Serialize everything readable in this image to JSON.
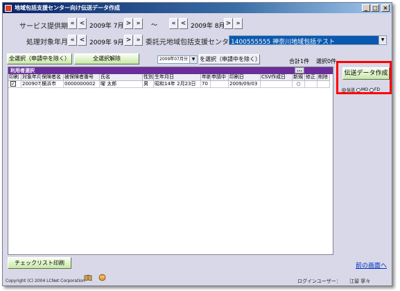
{
  "window": {
    "title": "地域包括支援センター向け伝送データ作成",
    "btn_minimize": "_",
    "btn_maximize": "□",
    "btn_close": "×"
  },
  "filters": {
    "service_period_label": "サービス提供期間",
    "period_from": "2009年 7月",
    "tilde": "～",
    "period_to": "2009年 8月",
    "process_month_label": "処理対象年月",
    "process_month": "2009年 9月",
    "consign_label": "委託元地域包括支援センター",
    "consign_value": "1400555555 神奈川地域包括テスト",
    "nav_first": "«",
    "nav_prev": "<",
    "nav_next": ">",
    "nav_last": "»"
  },
  "toolbar": {
    "select_all": "全選択（申請中を除く）",
    "deselect_all": "全選択解除",
    "month_combo": "2009年07月分",
    "select_month": "を選択（申請中を除く）",
    "total_label": "合計",
    "total_count": "1件",
    "selected_label": "選択",
    "selected_count": "0件"
  },
  "grid": {
    "title": "利用者選択",
    "ellipsis": "...",
    "columns": [
      "印刷",
      "対象年月",
      "保険者名",
      "被保険者番号",
      "氏名",
      "性別",
      "生年月日",
      "年齢",
      "申請中",
      "印刷日",
      "CSV作成日",
      "新規",
      "修正",
      "削除"
    ],
    "rows": [
      {
        "print": "✓",
        "month": "200907",
        "insurer": "横浜市",
        "number": "0000000002",
        "name": "曜 太郎",
        "sex": "男",
        "birth": "昭和14年 2月23日",
        "age": "70",
        "applying": "",
        "print_date": "2009/09/03",
        "csv_date": "",
        "new": "○",
        "modify": "",
        "delete": ""
      }
    ]
  },
  "send_panel": {
    "create_button": "伝送データ作成",
    "opt_transmit": "伝送",
    "opt_mo": "MO",
    "opt_fd": "FD"
  },
  "footer": {
    "checklist_button": "チェックリスト印刷",
    "back_link": "前の画面へ",
    "copyright": "Copyright (C) 2004 LCNet Corporation",
    "login_label": "ログインユーザー：",
    "login_user": "江留 寧々"
  },
  "colors": {
    "title_bar": "#0a246a",
    "grid_title": "#6a2e9a",
    "highlight_box": "#ff0000",
    "combo_selected": "#0a58b0"
  }
}
